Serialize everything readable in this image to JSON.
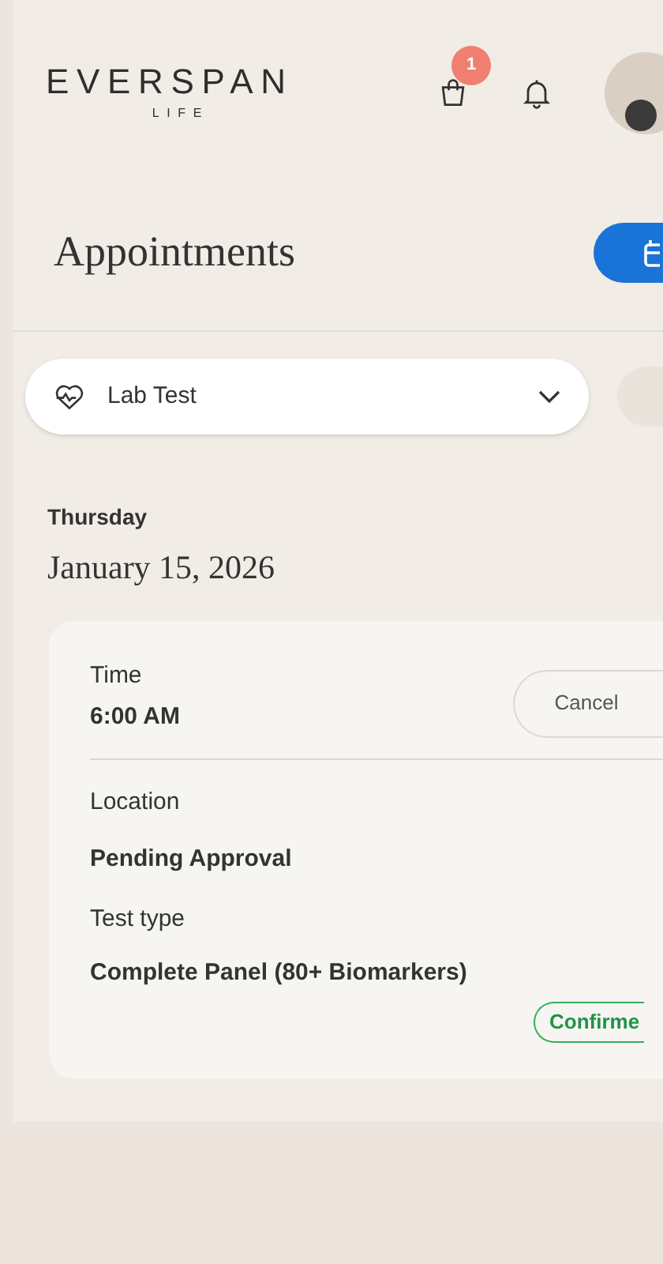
{
  "header": {
    "logo": {
      "wordmark": "EVERSPAN",
      "tagline": "LIFE"
    },
    "cart_count": "1"
  },
  "page_title": "Appointments",
  "filter": {
    "value": "Lab Test"
  },
  "day": {
    "weekday": "Thursday",
    "date": "January 15, 2026"
  },
  "appointment": {
    "time_label": "Time",
    "time": "6:00 AM",
    "cancel": "Cancel",
    "location_label": "Location",
    "location": "Pending Approval",
    "type_label": "Test type",
    "type": "Complete Panel (80+ Biomarkers)",
    "status": "Confirme"
  }
}
